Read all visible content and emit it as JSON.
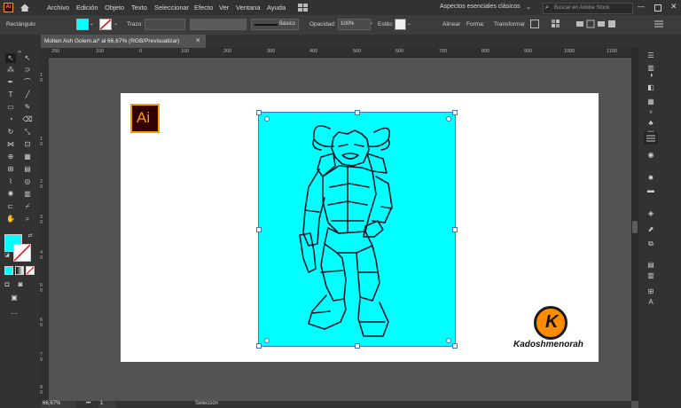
{
  "app": {
    "logo": "Ai"
  },
  "menu": [
    "Archivo",
    "Edición",
    "Objeto",
    "Texto",
    "Seleccionar",
    "Efecto",
    "Ver",
    "Ventana",
    "Ayuda"
  ],
  "workspace": {
    "name": "Aspectos esenciales clásicos",
    "search_placeholder": "Buscar en Adobe Stock"
  },
  "control": {
    "selection_label": "Rectángulo",
    "fill_color": "#00ffff",
    "stroke_label": "Trazo:",
    "stroke_profile": "Básico",
    "opacity_label": "Opacidad:",
    "opacity_value": "100%",
    "style_label": "Estilo:",
    "align_label": "Alinear",
    "shape_label": "Forma:",
    "transform_label": "Transformar"
  },
  "document": {
    "tab_title": "Molten Ash Golem.ai* al 66,67% (RGB/Previsualizar)",
    "close": "×"
  },
  "rulers": {
    "h": [
      "200",
      "100",
      "0",
      "100",
      "200",
      "300",
      "400",
      "500",
      "600",
      "700",
      "800",
      "900",
      "1000",
      "1100",
      "1200"
    ],
    "v": [
      "1",
      "0",
      "1",
      "0",
      "2",
      "0",
      "3",
      "0",
      "4",
      "0",
      "5",
      "0",
      "6",
      "0",
      "7",
      "0",
      "8",
      "0"
    ]
  },
  "artwork": {
    "rect_color": "#00ffff",
    "ai_badge": "Ai",
    "watermark_letter": "K",
    "watermark_text": "Kadoshmenorah"
  },
  "status": {
    "zoom": "66,67%",
    "artboard": "1",
    "tool": "Selección"
  },
  "colors": {
    "accent_orange": "#ff9a00",
    "selection_blue": "#3d74d9"
  }
}
